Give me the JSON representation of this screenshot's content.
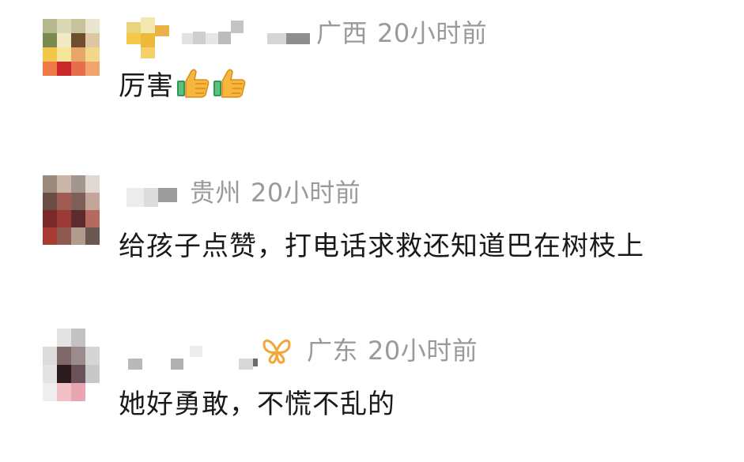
{
  "comments": [
    {
      "location": "广西",
      "time": "20小时前",
      "text": "厉害",
      "emoji": [
        "thumbs-up",
        "thumbs-up"
      ]
    },
    {
      "location": "贵州",
      "time": "20小时前",
      "text": "给孩子点赞，打电话求救还知道巴在树枝上"
    },
    {
      "location": "广东",
      "time": "20小时前",
      "text": "她好勇敢，不慌不乱的",
      "badge": "butterfly-icon"
    }
  ]
}
